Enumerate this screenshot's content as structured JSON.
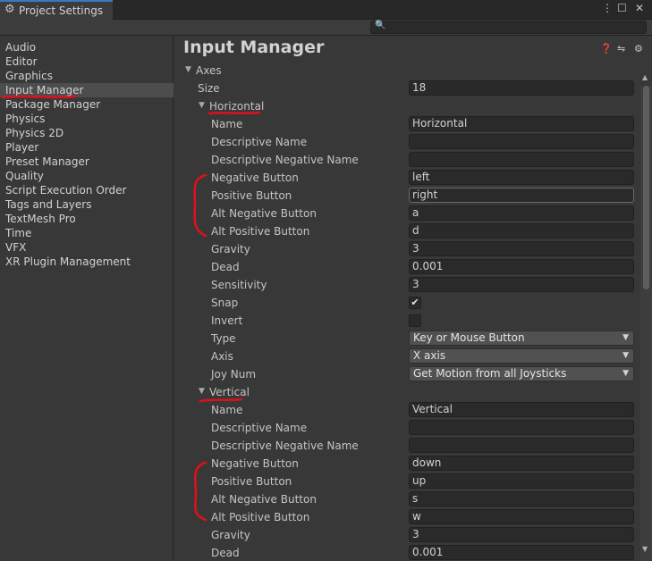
{
  "window": {
    "tab_title": "Project Settings",
    "tab_icon": "gear-icon"
  },
  "search": {
    "placeholder": ""
  },
  "sidebar": {
    "items": [
      {
        "label": "Audio"
      },
      {
        "label": "Editor"
      },
      {
        "label": "Graphics"
      },
      {
        "label": "Input Manager",
        "selected": true
      },
      {
        "label": "Package Manager"
      },
      {
        "label": "Physics"
      },
      {
        "label": "Physics 2D"
      },
      {
        "label": "Player"
      },
      {
        "label": "Preset Manager"
      },
      {
        "label": "Quality"
      },
      {
        "label": "Script Execution Order"
      },
      {
        "label": "Tags and Layers"
      },
      {
        "label": "TextMesh Pro"
      },
      {
        "label": "Time"
      },
      {
        "label": "VFX"
      },
      {
        "label": "XR Plugin Management"
      }
    ]
  },
  "main": {
    "title": "Input Manager",
    "axes_label": "Axes",
    "size_label": "Size",
    "size_value": "18",
    "horizontal": {
      "label": "Horizontal",
      "name_label": "Name",
      "name_value": "Horizontal",
      "descriptive_name_label": "Descriptive Name",
      "descriptive_name_value": "",
      "descriptive_negative_name_label": "Descriptive Negative Name",
      "descriptive_negative_name_value": "",
      "negative_button_label": "Negative Button",
      "negative_button_value": "left",
      "positive_button_label": "Positive Button",
      "positive_button_value": "right",
      "alt_negative_button_label": "Alt Negative Button",
      "alt_negative_button_value": "a",
      "alt_positive_button_label": "Alt Positive Button",
      "alt_positive_button_value": "d",
      "gravity_label": "Gravity",
      "gravity_value": "3",
      "dead_label": "Dead",
      "dead_value": "0.001",
      "sensitivity_label": "Sensitivity",
      "sensitivity_value": "3",
      "snap_label": "Snap",
      "snap_checked": true,
      "invert_label": "Invert",
      "invert_checked": false,
      "type_label": "Type",
      "type_value": "Key or Mouse Button",
      "axis_label": "Axis",
      "axis_value": "X axis",
      "joy_num_label": "Joy Num",
      "joy_num_value": "Get Motion from all Joysticks"
    },
    "vertical": {
      "label": "Vertical",
      "name_label": "Name",
      "name_value": "Vertical",
      "descriptive_name_label": "Descriptive Name",
      "descriptive_name_value": "",
      "descriptive_negative_name_label": "Descriptive Negative Name",
      "descriptive_negative_name_value": "",
      "negative_button_label": "Negative Button",
      "negative_button_value": "down",
      "positive_button_label": "Positive Button",
      "positive_button_value": "up",
      "alt_negative_button_label": "Alt Negative Button",
      "alt_negative_button_value": "s",
      "alt_positive_button_label": "Alt Positive Button",
      "alt_positive_button_value": "w",
      "gravity_label": "Gravity",
      "gravity_value": "3",
      "dead_label": "Dead",
      "dead_value": "0.001"
    }
  },
  "colors": {
    "annotation": "#e0101a",
    "accent": "#3a79bb",
    "panel": "#383838",
    "field": "#2a2a2a"
  }
}
